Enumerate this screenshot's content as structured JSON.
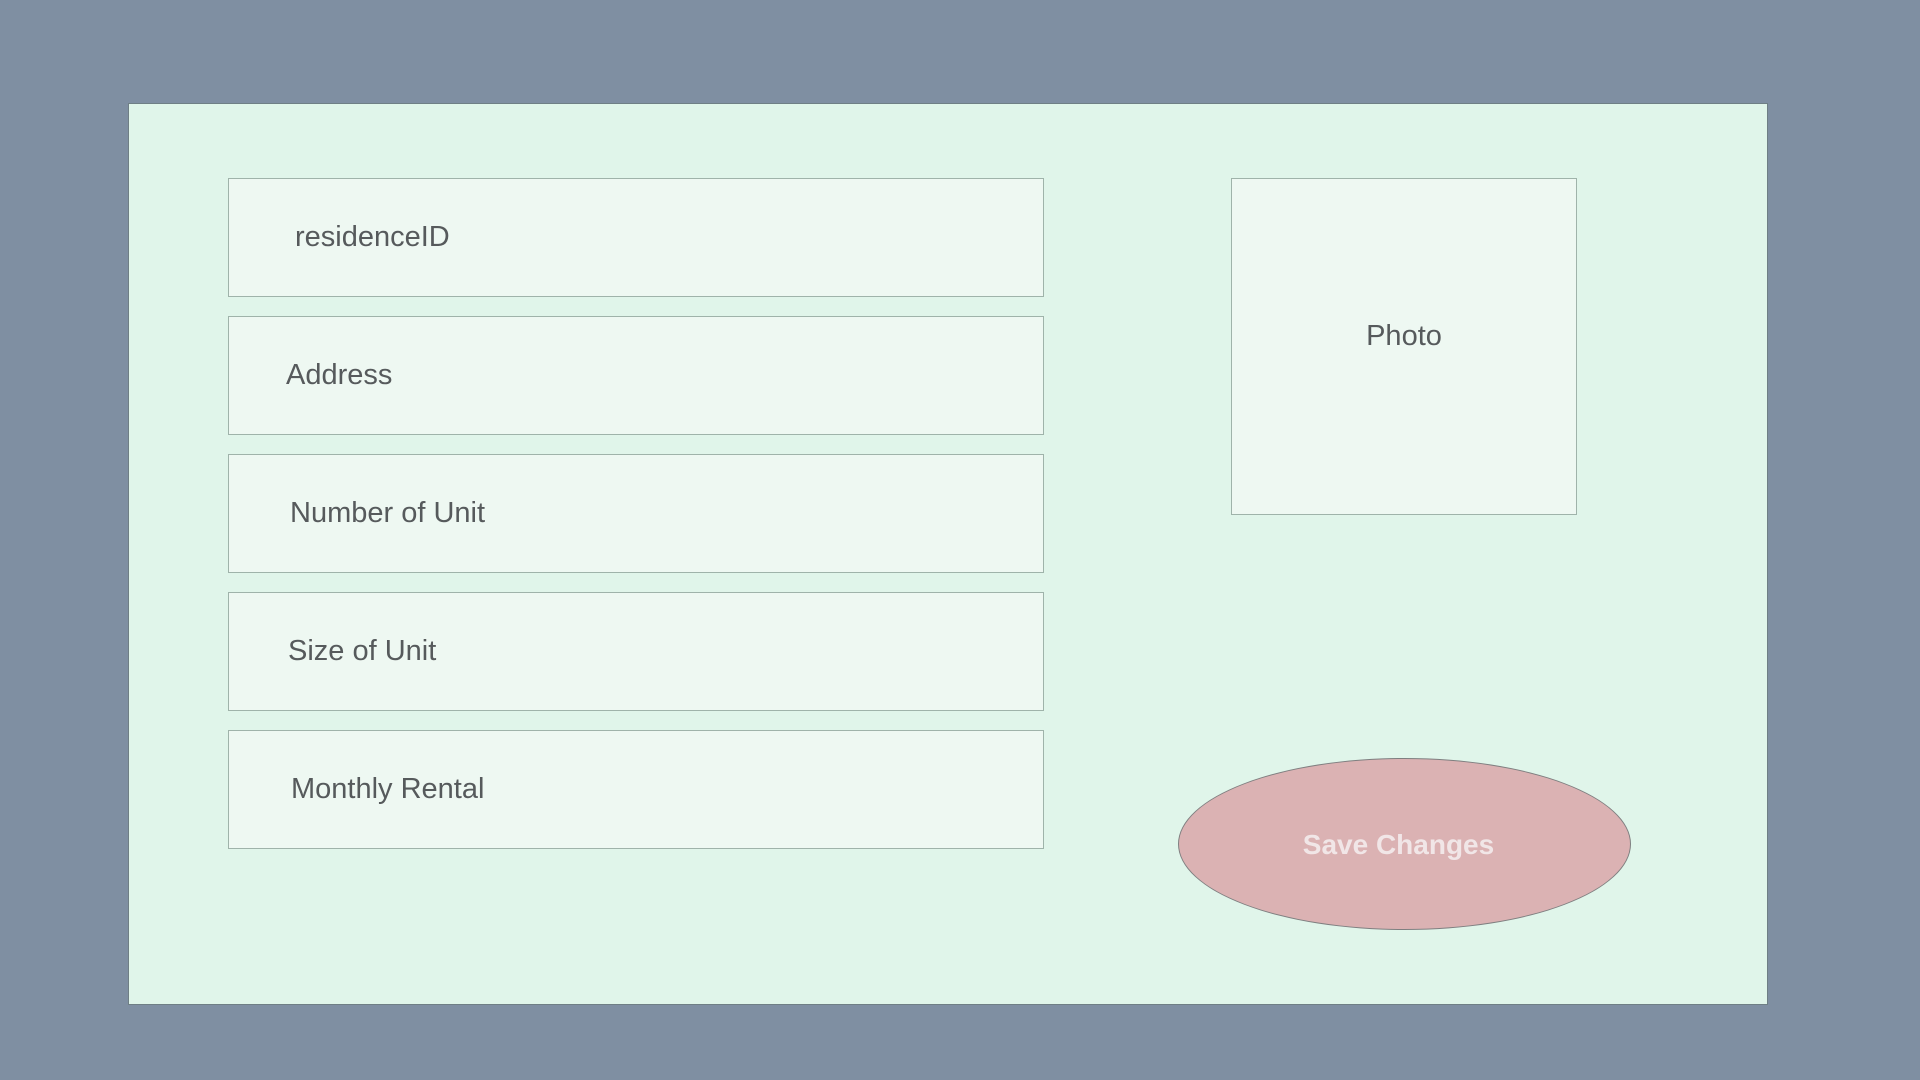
{
  "form": {
    "fields": [
      {
        "label": "residenceID"
      },
      {
        "label": "Address"
      },
      {
        "label": "Number of Unit"
      },
      {
        "label": "Size of Unit"
      },
      {
        "label": "Monthly Rental"
      }
    ],
    "photo": {
      "label": "Photo"
    },
    "save_button": {
      "label": "Save Changes"
    }
  },
  "colors": {
    "background": "#7f8fa2",
    "panel": "#e0f5ea",
    "field": "#eef8f2",
    "button": "#dbb2b3",
    "button_text": "#f1e6e7",
    "label_text": "#565a5c"
  }
}
